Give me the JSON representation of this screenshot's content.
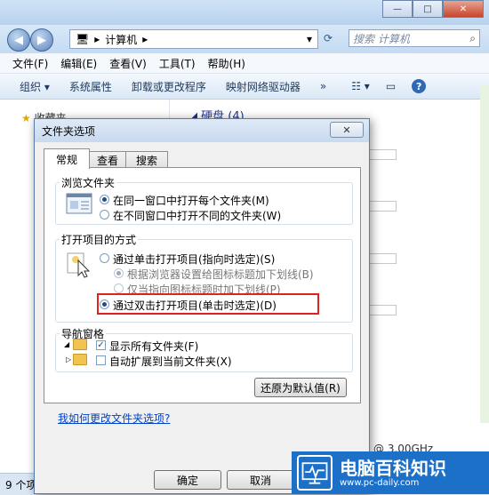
{
  "explorer": {
    "address_path": "计算机",
    "search_placeholder": "搜索 计算机",
    "menu": [
      "文件(F)",
      "编辑(E)",
      "查看(V)",
      "工具(T)",
      "帮助(H)"
    ],
    "toolbar": [
      "组织 ▾",
      "系统属性",
      "卸载或更改程序",
      "映射网络驱动器",
      "»"
    ],
    "favorites_label": "收藏夹",
    "section_header": "硬盘 (4)",
    "status_text": "9 个项",
    "cpu_text": "@ 3.00GHz"
  },
  "dialog": {
    "title": "文件夹选项",
    "tabs": [
      "常规",
      "查看",
      "搜索"
    ],
    "browse_group": {
      "label": "浏览文件夹",
      "options": [
        "在同一窗口中打开每个文件夹(M)",
        "在不同窗口中打开不同的文件夹(W)"
      ]
    },
    "click_group": {
      "label": "打开项目的方式",
      "single_click": "通过单击打开项目(指向时选定)(S)",
      "underline_browser": "根据浏览器设置给图标标题加下划线(B)",
      "underline_point": "仅当指向图标标题时加下划线(P)",
      "double_click": "通过双击打开项目(单击时选定)(D)"
    },
    "nav_group": {
      "label": "导航窗格",
      "show_all": "显示所有文件夹(F)",
      "auto_expand": "自动扩展到当前文件夹(X)"
    },
    "restore_button": "还原为默认值(R)",
    "help_link": "我如何更改文件夹选项?",
    "ok_button": "确定",
    "cancel_button": "取消"
  },
  "watermark": {
    "brand": "电脑百科知识",
    "url": "www.pc-daily.com"
  }
}
